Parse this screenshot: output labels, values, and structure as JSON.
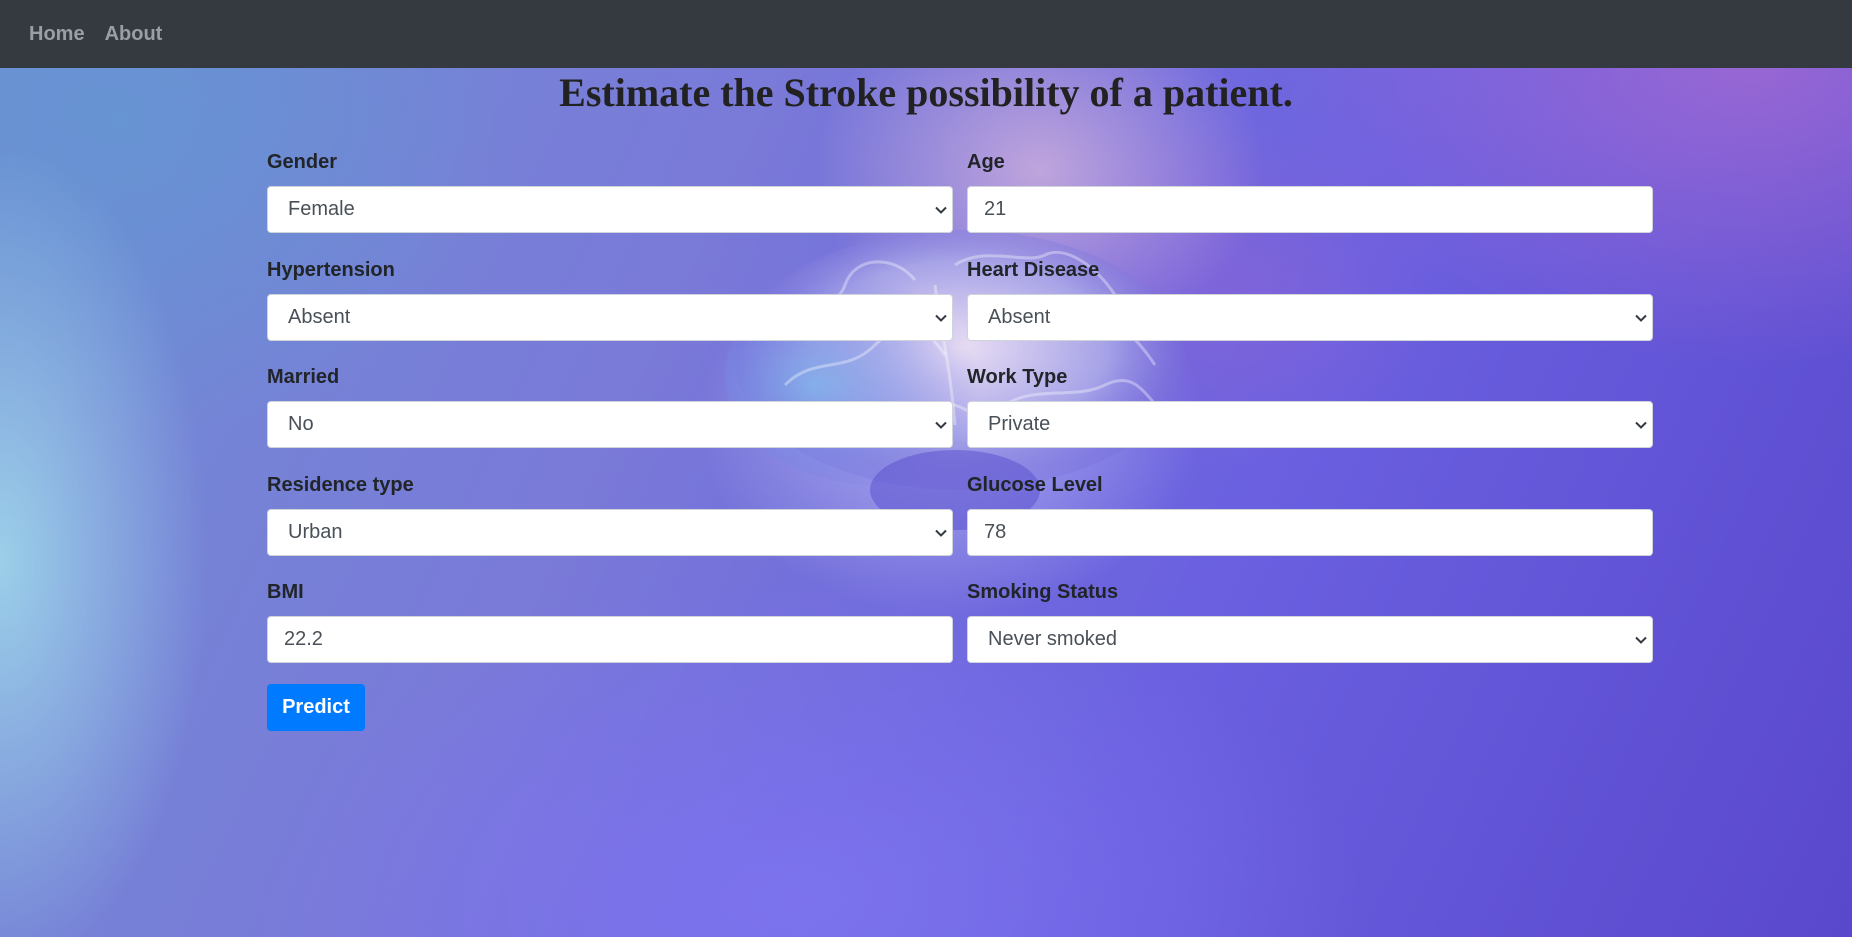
{
  "nav": {
    "home": "Home",
    "about": "About"
  },
  "title": "Estimate the Stroke possibility of a patient.",
  "fields": {
    "gender": {
      "label": "Gender",
      "value": "Female"
    },
    "age": {
      "label": "Age",
      "value": "21"
    },
    "hypertension": {
      "label": "Hypertension",
      "value": "Absent"
    },
    "heart_disease": {
      "label": "Heart Disease",
      "value": "Absent"
    },
    "married": {
      "label": "Married",
      "value": "No"
    },
    "work_type": {
      "label": "Work Type",
      "value": "Private"
    },
    "residence_type": {
      "label": "Residence type",
      "value": "Urban"
    },
    "glucose_level": {
      "label": "Glucose Level",
      "value": "78"
    },
    "bmi": {
      "label": "BMI",
      "value": "22.2"
    },
    "smoking_status": {
      "label": "Smoking Status",
      "value": "Never smoked"
    }
  },
  "predict_button": "Predict",
  "colors": {
    "navbar": "#343a40",
    "primary": "#007bff"
  },
  "background_image": "brain-illustration"
}
